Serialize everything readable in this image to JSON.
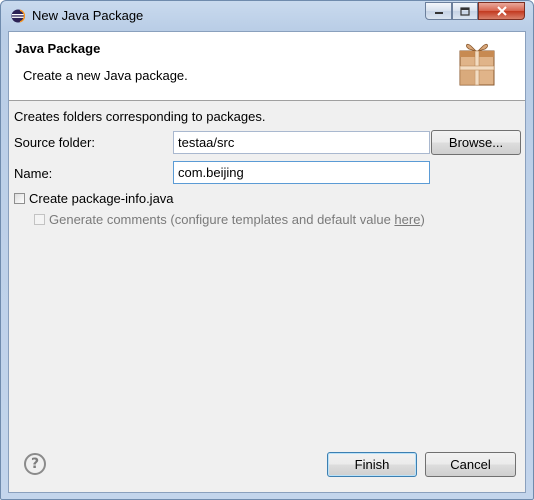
{
  "window": {
    "title": "New Java Package"
  },
  "header": {
    "title": "Java Package",
    "description": "Create a new Java package."
  },
  "info_text": "Creates folders corresponding to packages.",
  "form": {
    "source_folder_label": "Source folder:",
    "source_folder_value": "testaa/src",
    "browse_label": "Browse...",
    "name_label": "Name:",
    "name_value": "com.beijing",
    "create_package_info_label": "Create package-info.java",
    "generate_comments_prefix": "Generate comments (configure templates and default value ",
    "generate_comments_link": "here",
    "generate_comments_suffix": ")"
  },
  "footer": {
    "help_symbol": "?",
    "finish_label": "Finish",
    "cancel_label": "Cancel"
  },
  "icons": {
    "app": "eclipse-icon",
    "header": "package-icon",
    "help": "help-icon"
  }
}
